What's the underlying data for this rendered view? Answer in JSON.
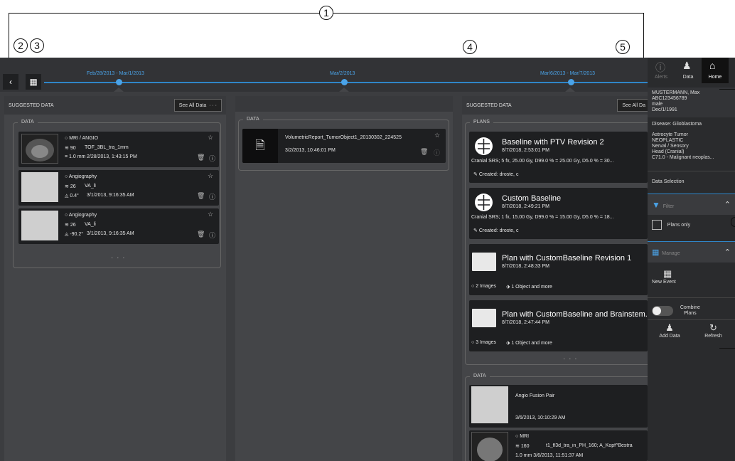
{
  "callouts": [
    "1",
    "2",
    "3",
    "4",
    "5"
  ],
  "timeline": {
    "back": "‹",
    "labels": [
      "Feb/28/2013 - Mar/1/2013",
      "Mar/2/2013",
      "Mar/6/2013 - Mar/7/2013"
    ]
  },
  "col1": {
    "title": "SUGGESTED DATA",
    "see_all": "See All Data",
    "more": "· · ·",
    "group": "DATA",
    "cards": [
      {
        "type": "MRI / ANGIO",
        "count": "90",
        "name": "TOF_3BL_tra_1mm",
        "thick": "1.0 mm",
        "date": "2/28/2013, 1:43:15 PM"
      },
      {
        "type": "Angiography",
        "count": "26",
        "name": "VA_li",
        "thick": "0.4°",
        "date": "3/1/2013, 9:16:35 AM"
      },
      {
        "type": "Angiography",
        "count": "26",
        "name": "VA_li",
        "thick": "-90.2°",
        "date": "3/1/2013, 9:16:35 AM"
      }
    ],
    "group_more": "· · ·"
  },
  "col2": {
    "group": "DATA",
    "card": {
      "name": "VolumetricReport_TumorObject1_20130302_224525",
      "date": "3/2/2013, 10:46:01 PM"
    }
  },
  "col3": {
    "title": "SUGGESTED DATA",
    "see_all": "See All Da",
    "plans_group": "PLANS",
    "plans": [
      {
        "title": "Baseline with PTV Revision 2",
        "date": "8/7/2018, 2:53:01 PM",
        "desc": "Cranial SRS; 5 fx, 25.00 Gy, D99.0 % = 25.00 Gy, D5.0 % = 30...",
        "created": "Created:  droste, c"
      },
      {
        "title": "Custom Baseline",
        "date": "8/7/2018, 2:49:21 PM",
        "desc": "Cranial SRS; 1 fx, 15.00 Gy, D99.0 % = 15.00 Gy, D5.0 % = 18...",
        "created": "Created:  droste, c"
      },
      {
        "title": "Plan with CustomBaseline Revision 1",
        "date": "8/7/2018, 2:48:33 PM",
        "images": "2 Images",
        "objects": "1 Object and more"
      },
      {
        "title": "Plan with CustomBaseline and Brainstem...",
        "date": "8/7/2018, 2:47:44 PM",
        "images": "3 Images",
        "objects": "1 Object and more"
      }
    ],
    "plans_more": "· · ·",
    "data_group": "DATA",
    "data": [
      {
        "name": "Angio Fusion Pair",
        "date": "3/6/2013, 10:10:29 AM"
      },
      {
        "type": "MRI",
        "count": "160",
        "name": "t1_fl3d_tra_in_PH_160; A_Kopf^Bestra",
        "date": "1.0 mm  3/6/2013, 11:51:37 AM"
      }
    ]
  },
  "side": {
    "alerts": "Alerts",
    "data": "Data",
    "home": "Home",
    "patient": {
      "name": "MUSTERMANN, Max",
      "id": "ABC123456789",
      "sex": "male",
      "dob": "Dec/1/1991"
    },
    "disease_label": "Disease:",
    "disease": "Glioblastoma",
    "diag": [
      "Astrocyte Tumor",
      "NEOPLASTIC",
      "Nerval / Sensory",
      "Head (Cranial)",
      "C71.0 - Malignant neoplas..."
    ],
    "data_selection": "Data Selection",
    "filter": "Filter",
    "plans_only": "Plans only",
    "manage": "Manage",
    "new_event": "New Event",
    "combine": "Combine Plans",
    "add_data": "Add Data",
    "refresh": "Refresh"
  },
  "colors": {
    "accent": "#2f86c8",
    "bg": "#3c3d40"
  }
}
